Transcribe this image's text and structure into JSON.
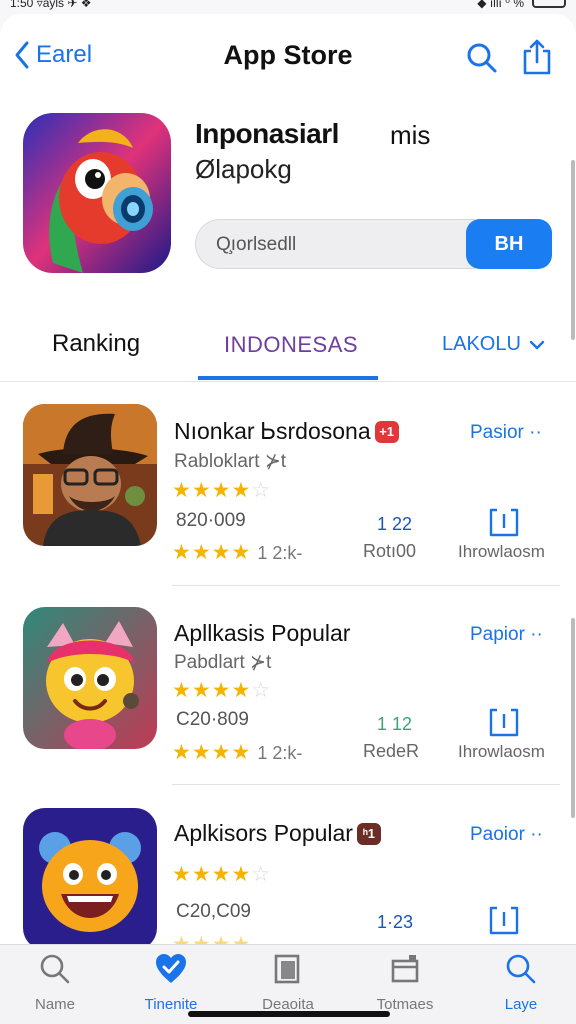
{
  "status_bar": {
    "time": "1:50 ▿ayls ✈ ❖",
    "right": "◆ ıllı ⁰ %"
  },
  "nav": {
    "back_label": "Earel",
    "title": "App Store"
  },
  "hero": {
    "title": "Inponasiarl",
    "title_suffix": "mis",
    "subtitle": "Ølapokg",
    "search_value": "Q̧ıorlsedll",
    "button_label": "BH"
  },
  "tabs": {
    "ranking": "Ranking",
    "indonesia": "INDONESAS",
    "lokal": "LAKOLU"
  },
  "apps": [
    {
      "name": "Nıonkar Ꮟsrdosona",
      "badge": "+1",
      "badge_color": "#e0383a",
      "subtitle": "Rabloklart ⊁t",
      "price": "820·009",
      "rating": 3.5,
      "rating_count": "1 2:k-",
      "get_label": "Pasior ··",
      "rank": "1 22",
      "rank_label": "Rotı00",
      "download_label": "Ihrowlaosm"
    },
    {
      "name": "Apllkasis Popular",
      "badge": "",
      "badge_color": "",
      "subtitle": "Pabdlart ⊁t",
      "price": "C20·809",
      "rating": 4.5,
      "rating_count": "1 2:k-",
      "get_label": "Papior ··",
      "rank": "1 12",
      "rank_label": "RedeR",
      "download_label": "Ihrowlaosm"
    },
    {
      "name": "Aplkisors Popular",
      "badge": "ʰ1",
      "badge_color": "#6b2d26",
      "subtitle": "",
      "price": "C20,C09",
      "rating": 4,
      "rating_count": "",
      "get_label": "Paoior ··",
      "rank": "1·23",
      "rank_label": "",
      "download_label": ""
    }
  ],
  "tabbar": [
    {
      "label": "Name",
      "icon": "search-icon",
      "active": false
    },
    {
      "label": "Tinenite",
      "icon": "heart-check-icon",
      "active": true
    },
    {
      "label": "Deaoita",
      "icon": "book-icon",
      "active": false
    },
    {
      "label": "Totmaes",
      "icon": "inbox-icon",
      "active": false
    },
    {
      "label": "Laye",
      "icon": "search-icon",
      "active": true
    }
  ],
  "colors": {
    "accent": "#1a73e8",
    "button": "#1a7df2",
    "star": "#f5b400"
  }
}
